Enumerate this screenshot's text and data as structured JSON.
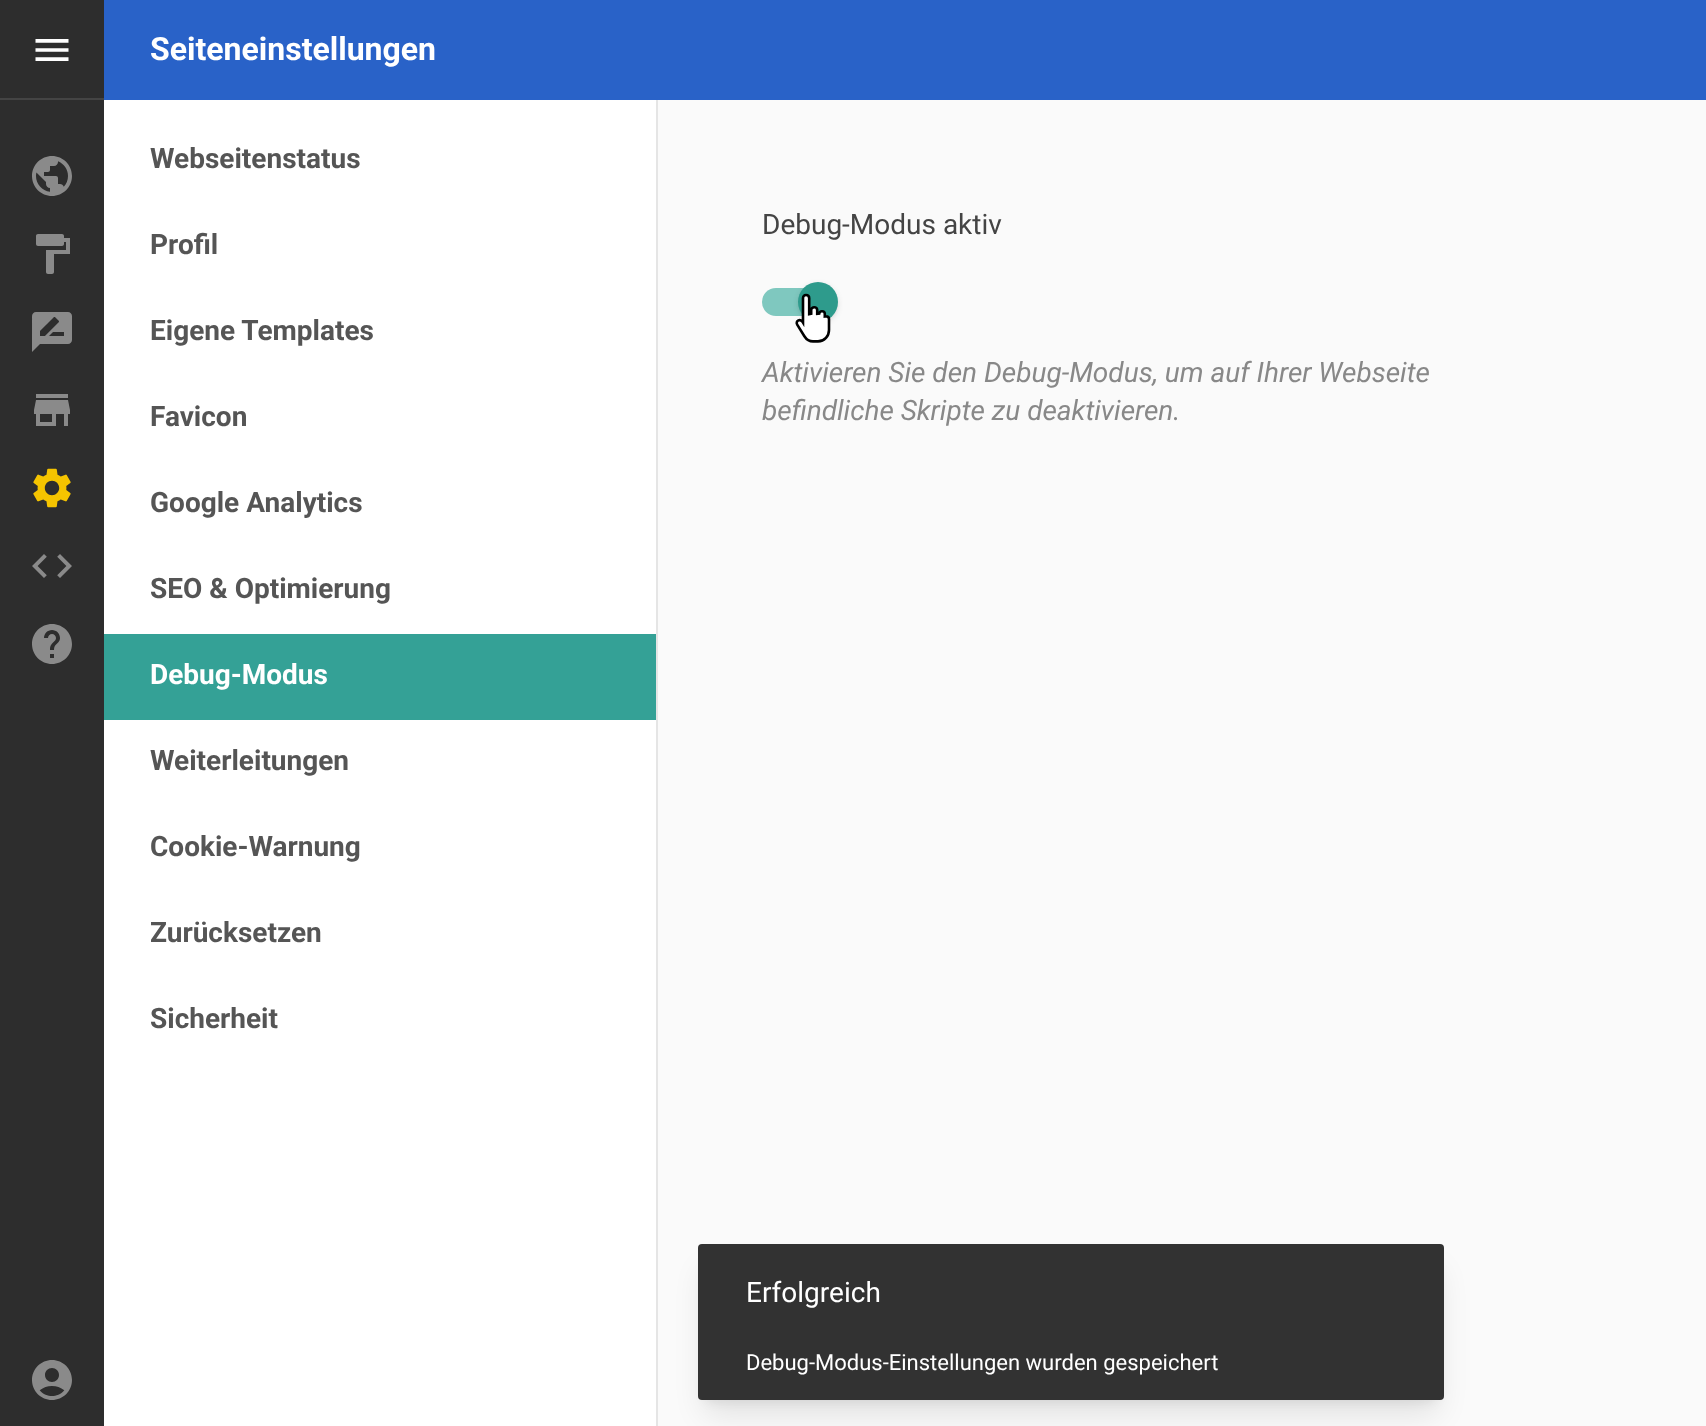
{
  "header": {
    "title": "Seiteneinstellungen"
  },
  "rail": {
    "items": [
      {
        "selected": false
      },
      {
        "selected": false
      },
      {
        "selected": false
      },
      {
        "selected": false
      },
      {
        "selected": true
      },
      {
        "selected": false
      },
      {
        "selected": false
      }
    ]
  },
  "sidebar": {
    "items": [
      {
        "label": "Webseitenstatus",
        "selected": false
      },
      {
        "label": "Profil",
        "selected": false
      },
      {
        "label": "Eigene Templates",
        "selected": false
      },
      {
        "label": "Favicon",
        "selected": false
      },
      {
        "label": "Google Analytics",
        "selected": false
      },
      {
        "label": "SEO & Optimierung",
        "selected": false
      },
      {
        "label": "Debug-Modus",
        "selected": true
      },
      {
        "label": "Weiterleitungen",
        "selected": false
      },
      {
        "label": "Cookie-Warnung",
        "selected": false
      },
      {
        "label": "Zurücksetzen",
        "selected": false
      },
      {
        "label": "Sicherheit",
        "selected": false
      }
    ]
  },
  "setting": {
    "label": "Debug-Modus aktiv",
    "on": true,
    "description": "Aktivieren Sie den Debug-Modus, um auf Ihrer Webseite befindliche Skripte zu deaktivieren."
  },
  "toast": {
    "title": "Erfolgreich",
    "message": "Debug-Modus-Einstellungen wurden gespeichert"
  }
}
